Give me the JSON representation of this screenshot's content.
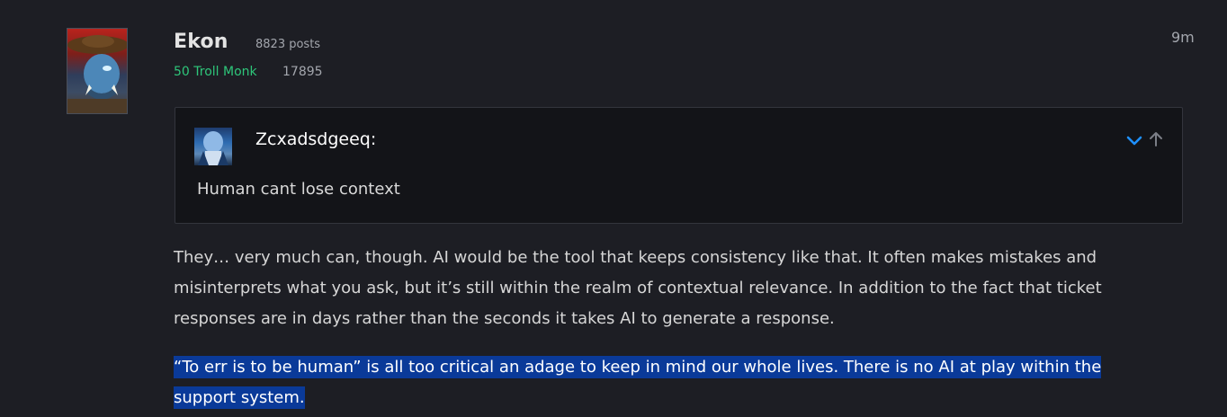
{
  "post": {
    "author": "Ekon",
    "posts": "8823 posts",
    "character": "50 Troll Monk",
    "points": "17895",
    "time": "9m",
    "quote": {
      "author": "Zcxadsdgeeq:",
      "text": "Human cant lose context",
      "expand_icon": "chevron-down-icon",
      "goto_icon": "arrow-up-icon"
    },
    "paragraphs": [
      "They… very much can, though. AI would be the tool that keeps consistency like that. It often makes mistakes and misinterprets what you ask, but it’s still within the realm of contextual relevance. In addition to the fact that ticket responses are in days rather than the seconds it takes AI to generate a response.",
      "“To err is to be human” is all too critical an adage to keep in mind our whole lives. There is no AI at play within the support system."
    ]
  },
  "colors": {
    "background": "#1d1e24",
    "quote_background": "#131418",
    "class_color": "#2ec67a",
    "accent": "#1e90ff",
    "selection": "#0a3a99"
  }
}
